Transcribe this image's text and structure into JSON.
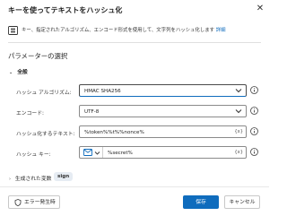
{
  "dialog": {
    "title": "キーを使ってテキストをハッシュ化",
    "description": "キー、指定されたアルゴリズム、エンコード形式を使用して、文字列をハッシュ化します",
    "details_link": "詳細"
  },
  "section": {
    "title": "パラメーターの選択",
    "group_label": "全般"
  },
  "fields": {
    "algorithm": {
      "label": "ハッシュ アルゴリズム:",
      "value": "HMAC SHA256"
    },
    "encoding": {
      "label": "エンコード:",
      "value": "UTF-8"
    },
    "text": {
      "label": "ハッシュ化するテキスト:",
      "value": "%token%%t%%nonce%",
      "var_button": "{x}"
    },
    "key": {
      "label": "ハッシュ キー:",
      "value": "%secret%",
      "var_button": "{x}"
    }
  },
  "variables": {
    "label": "生成された変数",
    "badge": "sign"
  },
  "footer": {
    "error_button": "エラー発生時",
    "save_button": "保存",
    "cancel_button": "キャンセル"
  },
  "colors": {
    "accent": "#0f6cbd",
    "text": "#242424",
    "border": "#8a8a8a"
  },
  "icons": {
    "close": "close-icon",
    "hash": "hash-icon",
    "info": "info-icon",
    "dropdown": "chevron-down-icon",
    "envelope": "envelope-icon",
    "shield": "shield-icon"
  }
}
